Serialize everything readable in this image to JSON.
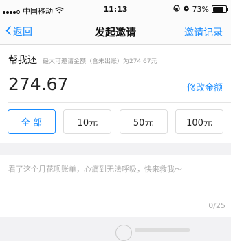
{
  "status_bar": {
    "carrier": "中国移动",
    "time": "11:13",
    "battery_percent": "73%"
  },
  "nav": {
    "back_label": "返回",
    "title": "发起邀请",
    "right_action": "邀请记录"
  },
  "invite": {
    "label": "帮我还",
    "hint": "最大可邀请金额（含未出账）为274.67元",
    "amount": "274.67",
    "modify_label": "修改金额",
    "options": [
      {
        "label": "全 部",
        "selected": true
      },
      {
        "label": "10元",
        "selected": false
      },
      {
        "label": "50元",
        "selected": false
      },
      {
        "label": "100元",
        "selected": false
      }
    ]
  },
  "message": {
    "placeholder": "看了这个月花呗账单，心痛到无法呼吸，快来救我～",
    "counter": "0/25"
  },
  "colors": {
    "accent": "#1a8cff",
    "background": "#f2f2f4"
  }
}
